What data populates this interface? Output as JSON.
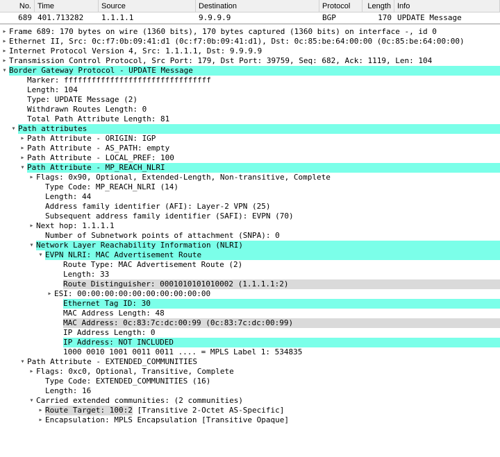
{
  "columns": [
    "No.",
    "Time",
    "Source",
    "Destination",
    "Protocol",
    "Length",
    "Info"
  ],
  "packet": {
    "no": "689",
    "time": "401.713282",
    "source": "1.1.1.1",
    "destination": "9.9.9.9",
    "protocol": "BGP",
    "length": "170",
    "info": "UPDATE Message"
  },
  "tree": [
    {
      "arrow": "closed",
      "indent": 1,
      "text": "Frame 689: 170 bytes on wire (1360 bits), 170 bytes captured (1360 bits) on interface -, id 0"
    },
    {
      "arrow": "closed",
      "indent": 1,
      "text": "Ethernet II, Src: 0c:f7:0b:09:41:d1 (0c:f7:0b:09:41:d1), Dst: 0c:85:be:64:00:00 (0c:85:be:64:00:00)"
    },
    {
      "arrow": "closed",
      "indent": 1,
      "text": "Internet Protocol Version 4, Src: 1.1.1.1, Dst: 9.9.9.9"
    },
    {
      "arrow": "closed",
      "indent": 1,
      "text": "Transmission Control Protocol, Src Port: 179, Dst Port: 39759, Seq: 682, Ack: 1119, Len: 104"
    },
    {
      "arrow": "open",
      "indent": 1,
      "text": "Border Gateway Protocol - UPDATE Message",
      "class": "teal"
    },
    {
      "arrow": "none",
      "indent": 3,
      "text": "Marker: ffffffffffffffffffffffffffffffff"
    },
    {
      "arrow": "none",
      "indent": 3,
      "text": "Length: 104"
    },
    {
      "arrow": "none",
      "indent": 3,
      "text": "Type: UPDATE Message (2)"
    },
    {
      "arrow": "none",
      "indent": 3,
      "text": "Withdrawn Routes Length: 0"
    },
    {
      "arrow": "none",
      "indent": 3,
      "text": "Total Path Attribute Length: 81"
    },
    {
      "arrow": "open",
      "indent": 2,
      "text": "Path attributes",
      "class": "teal"
    },
    {
      "arrow": "closed",
      "indent": 3,
      "text": "Path Attribute - ORIGIN: IGP"
    },
    {
      "arrow": "closed",
      "indent": 3,
      "text": "Path Attribute - AS_PATH: empty"
    },
    {
      "arrow": "closed",
      "indent": 3,
      "text": "Path Attribute - LOCAL_PREF: 100"
    },
    {
      "arrow": "open",
      "indent": 3,
      "text": "Path Attribute - MP_REACH_NLRI",
      "class": "teal"
    },
    {
      "arrow": "closed",
      "indent": 4,
      "text": "Flags: 0x90, Optional, Extended-Length, Non-transitive, Complete"
    },
    {
      "arrow": "none",
      "indent": 5,
      "text": "Type Code: MP_REACH_NLRI (14)"
    },
    {
      "arrow": "none",
      "indent": 5,
      "text": "Length: 44"
    },
    {
      "arrow": "none",
      "indent": 5,
      "text": "Address family identifier (AFI): Layer-2 VPN (25)"
    },
    {
      "arrow": "none",
      "indent": 5,
      "text": "Subsequent address family identifier (SAFI): EVPN (70)"
    },
    {
      "arrow": "closed",
      "indent": 4,
      "text": "Next hop: 1.1.1.1"
    },
    {
      "arrow": "none",
      "indent": 5,
      "text": "Number of Subnetwork points of attachment (SNPA): 0"
    },
    {
      "arrow": "open",
      "indent": 4,
      "text": "Network Layer Reachability Information (NLRI)",
      "class": "teal"
    },
    {
      "arrow": "open",
      "indent": 5,
      "text": "EVPN NLRI: MAC Advertisement Route",
      "class": "teal"
    },
    {
      "arrow": "none",
      "indent": 7,
      "text": "Route Type: MAC Advertisement Route (2)"
    },
    {
      "arrow": "none",
      "indent": 7,
      "text": "Length: 33"
    },
    {
      "arrow": "none",
      "indent": 7,
      "text": "Route Distinguisher: 0001010101010002 (1.1.1.1:2)",
      "class": "gray-sel"
    },
    {
      "arrow": "closed",
      "indent": 6,
      "text": "ESI: 00:00:00:00:00:00:00:00:00:00"
    },
    {
      "arrow": "none",
      "indent": 7,
      "text": "Ethernet Tag ID: 30",
      "class": "teal"
    },
    {
      "arrow": "none",
      "indent": 7,
      "text": "MAC Address Length: 48"
    },
    {
      "arrow": "none",
      "indent": 7,
      "text": "MAC Address: 0c:83:7c:dc:00:99 (0c:83:7c:dc:00:99)",
      "class": "gray-sel"
    },
    {
      "arrow": "none",
      "indent": 7,
      "text": "IP Address Length: 0"
    },
    {
      "arrow": "none",
      "indent": 7,
      "text": "IP Address: NOT INCLUDED",
      "class": "teal"
    },
    {
      "arrow": "none",
      "indent": 7,
      "text": "1000 0010 1001 0011 0011 .... = MPLS Label 1: 534835"
    },
    {
      "arrow": "open",
      "indent": 3,
      "text": "Path Attribute - EXTENDED_COMMUNITIES"
    },
    {
      "arrow": "closed",
      "indent": 4,
      "text": "Flags: 0xc0, Optional, Transitive, Complete"
    },
    {
      "arrow": "none",
      "indent": 5,
      "text": "Type Code: EXTENDED_COMMUNITIES (16)"
    },
    {
      "arrow": "none",
      "indent": 5,
      "text": "Length: 16"
    },
    {
      "arrow": "open",
      "indent": 4,
      "text": "Carried extended communities: (2 communities)"
    },
    {
      "arrow": "closed",
      "indent": 5,
      "text_parts": [
        {
          "text": "Route Target: 100:2",
          "class": "gray-sel"
        },
        {
          "text": " [Transitive 2-Octet AS-Specific]",
          "class": ""
        }
      ]
    },
    {
      "arrow": "closed",
      "indent": 5,
      "text": "Encapsulation: MPLS Encapsulation [Transitive Opaque]"
    }
  ]
}
